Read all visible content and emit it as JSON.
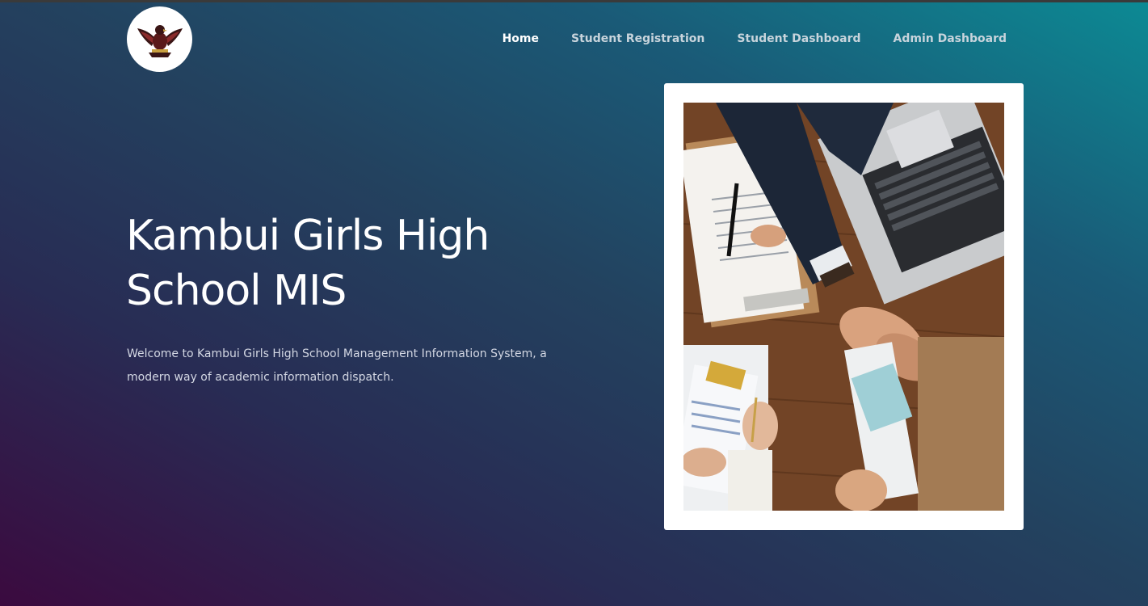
{
  "header": {
    "logo_icon": "eagle-crest-icon",
    "nav": [
      {
        "label": "Home",
        "active": true
      },
      {
        "label": "Student Registration",
        "active": false
      },
      {
        "label": "Student Dashboard",
        "active": false
      },
      {
        "label": "Admin Dashboard",
        "active": false
      }
    ]
  },
  "hero": {
    "title": "Kambui Girls High School MIS",
    "description": "Welcome to Kambui Girls High School Management Information System, a modern way of academic information dispatch.",
    "image_icon": "business-handshake-photo"
  },
  "colors": {
    "gradient_start": "#3b0a3f",
    "gradient_mid": "#23425f",
    "gradient_end": "#0c8a94",
    "nav_text": "#c8d4dc",
    "nav_active": "#ffffff"
  }
}
